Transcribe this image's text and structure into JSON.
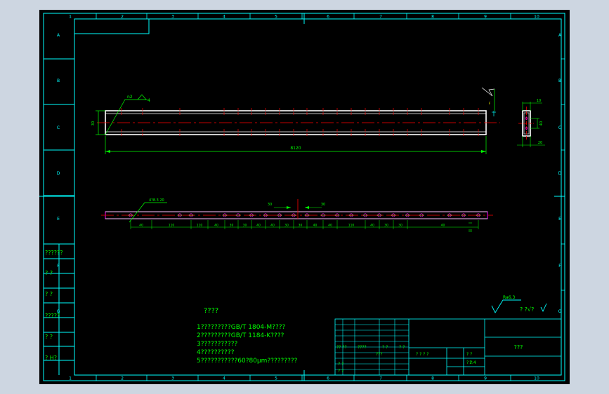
{
  "colors": {
    "background_app": "#cdd6e1",
    "sheet": "#000000",
    "frame": "#00ffff",
    "part": "#ffffff",
    "dimension": "#00ff00",
    "centerline": "#ff0000",
    "hole": "#ff00ff",
    "marker": "#ffff00"
  },
  "frame": {
    "columns": [
      "1",
      "2",
      "3",
      "4",
      "5",
      "6",
      "7",
      "8",
      "9",
      "10"
    ],
    "rows": [
      "A",
      "B",
      "C",
      "D",
      "E",
      "F",
      "G"
    ],
    "left_stamps": [
      "??????",
      "? ?",
      "? ?",
      "?????",
      "? ?",
      "? H?"
    ]
  },
  "views": {
    "main": {
      "total_length_dim": "8120",
      "height_dim": "30",
      "leader_note": "n2",
      "leader_value": "4"
    },
    "section": {
      "width_dim": "10",
      "height_dim": "40",
      "bottom_dim": "20"
    },
    "plan": {
      "hole_note": "4?8.3 20",
      "spacing_left": "30",
      "spacing_right": "30",
      "chain_labels": [
        "40",
        "110",
        "110",
        "40",
        "30",
        "30",
        "40",
        "40",
        "30",
        "30",
        "40",
        "40",
        "110",
        "40",
        "30",
        "30",
        "40"
      ]
    }
  },
  "notes": {
    "title": "????",
    "items": [
      "1?????????GB/T 1804-M????",
      "2?????????GB/T 1184-K????",
      "3???????????",
      "4??????????",
      "5???????????60?80μm?????????"
    ]
  },
  "roughness": {
    "value": "Ra6.3",
    "suffix": "? ?√?"
  },
  "title_block": {
    "drawing_name": "???",
    "labels": [
      "?? ??",
      "????",
      "? ?",
      "? ?",
      "???",
      "? ? ? ?",
      "? ?",
      "? ?",
      "1:4",
      "? ?",
      "? ?"
    ]
  }
}
